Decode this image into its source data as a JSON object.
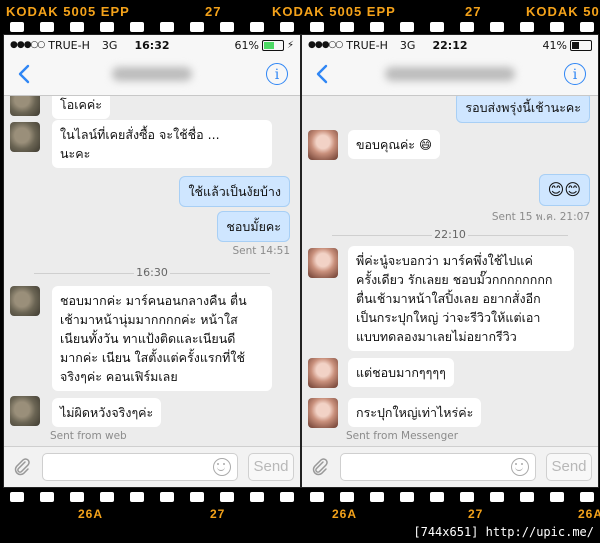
{
  "film": {
    "top_left": "KODAK 5005 EPP",
    "top_mid": "27",
    "top_right": "KODAK 5005 EPP",
    "top_mid2": "27",
    "top_far": "KODAK 50",
    "bottom_a": "26A",
    "bottom_b": "27",
    "bottom_c": "26A",
    "bottom_d": "27",
    "bottom_e": "26A",
    "watermark": "[744x651] http://upic.me/"
  },
  "left": {
    "status": {
      "carrier": "TRUE-H",
      "network": "3G",
      "time": "16:32",
      "battery": "61%",
      "battery_level": 0.61,
      "battery_color": "#4cd964"
    },
    "messages": [
      {
        "text": "โอเคค่ะ"
      },
      {
        "text": "ในไลน์ที่เคยสั่งซื้อ จะใช้ชื่อ ...\nนะคะ"
      },
      {
        "text": "ใช้แล้วเป็นงัยบ้าง"
      },
      {
        "text": "ชอบมั้ยคะ"
      },
      {
        "text": "Sent 14:51"
      },
      {
        "text": "16:30"
      },
      {
        "text": "ชอบมากค่ะ มาร์คนอนกลางคืน ตื่น\nเช้ามาหน้านุ่มมากกกกค่ะ หน้าใส\nเนียนทั้งวัน ทาแป้งติดและเนียนดี\nมากค่ะ เนียน ใสตั้งแต่ครั้งแรกที่ใช้\nจริงๆค่ะ คอนเฟิร์มเลย"
      },
      {
        "text": "ไม่ผิดหวังจริงๆค่ะ"
      },
      {
        "text": "Sent from web"
      }
    ],
    "input": {
      "send_label": "Send"
    }
  },
  "right": {
    "status": {
      "carrier": "TRUE-H",
      "network": "3G",
      "time": "22:12",
      "battery": "41%",
      "battery_level": 0.41,
      "battery_color": "#111111"
    },
    "messages": [
      {
        "text": "รอบส่งพรุ่งนี้เช้านะคะ"
      },
      {
        "text": "ขอบคุณค่ะ 😄"
      },
      {
        "text": "😊😊"
      },
      {
        "text": "Sent 15 พ.ค. 21:07"
      },
      {
        "text": "22:10"
      },
      {
        "text": "พี่ค่ะนู๋จะบอกว่า มาร์คพึ่งใช้ไปแค่\nครั้งเดียว รักเลยย ชอบมั๊วกกกกกกกก\nตื่นเช้ามาหน้าใสปิ้งเลย อยากสั่งอีก\nเป็นกระปุกใหญ่ ว่าจะรีวิวให้แต่เอา\nแบบทดลองมาเลยไม่อยากรีวิว"
      },
      {
        "text": "แต่ชอบมากๆๆๆๆ"
      },
      {
        "text": "กระปุกใหญ่เท่าไหร่ค่ะ"
      },
      {
        "text": "Sent from Messenger"
      }
    ],
    "input": {
      "send_label": "Send"
    }
  },
  "colors": {
    "accent": "#2f86f5",
    "film_text": "#f4a21a",
    "outgoing_bubble": "#cfe6ff"
  }
}
